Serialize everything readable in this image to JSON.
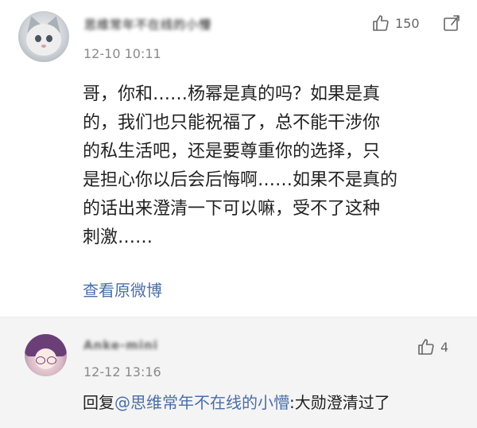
{
  "comment": {
    "username": "思维常年不在线的小懵",
    "time": "12-10 10:11",
    "likes": "150",
    "lines": [
      "哥，你和……杨幂是真的吗？如果是真",
      "的，我们也只能祝福了，总不能干涉你",
      "的私生活吧，还是要尊重你的选择，只",
      "是担心你以后会后悔啊……如果不是真的",
      "的话出来澄清一下可以嘛，受不了这种",
      "刺激……"
    ],
    "view_original": "查看原微博",
    "icons": {
      "like": "thumbs-up-icon",
      "share": "share-icon"
    }
  },
  "reply": {
    "username": "Anke-mini",
    "time": "12-12 13:16",
    "likes": "4",
    "prefix": "回复",
    "mention": "@思维常年不在线的小懵",
    "text": ":大勋澄清过了"
  },
  "colors": {
    "link": "#4a6ea6",
    "reply_bg": "#f4f4f4"
  }
}
